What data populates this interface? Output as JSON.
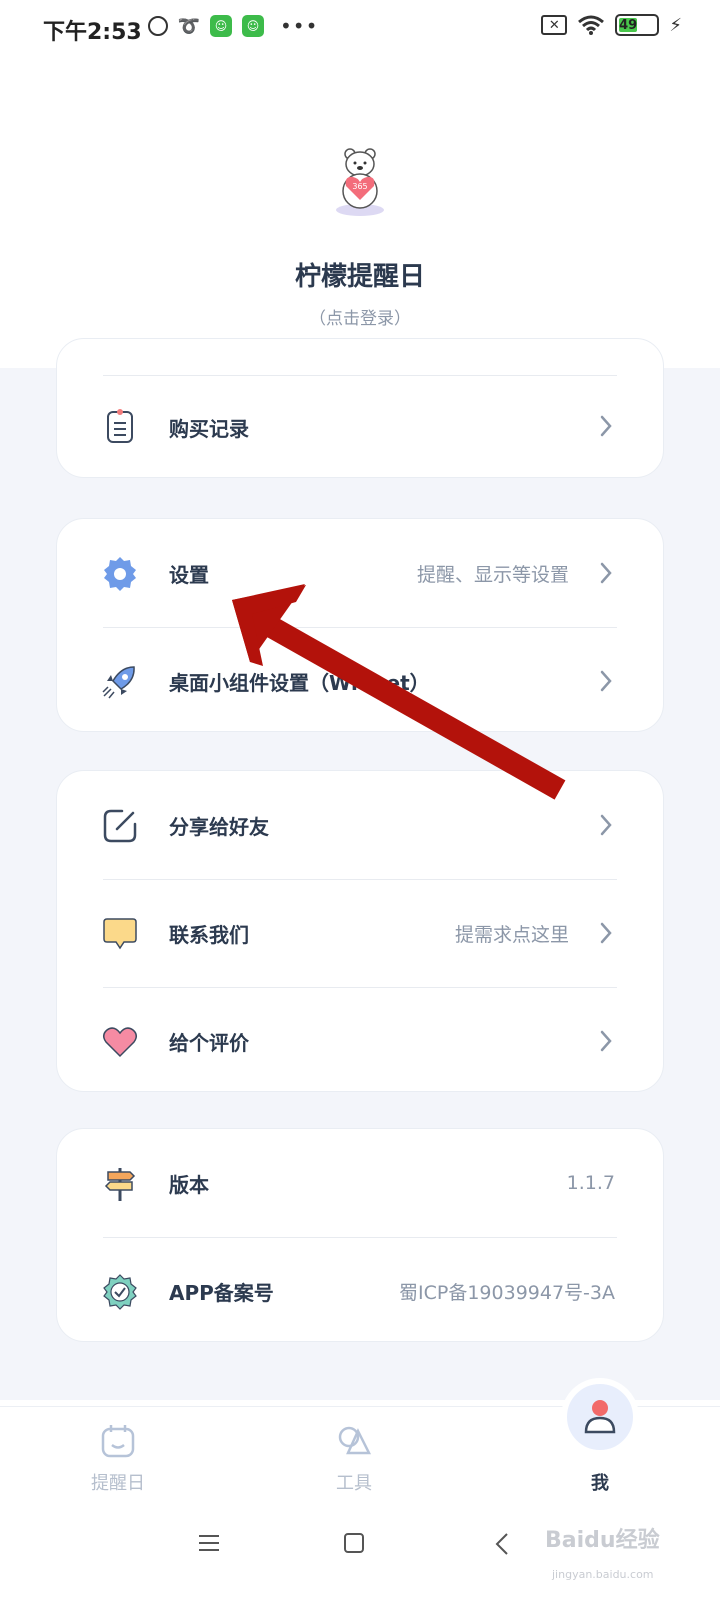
{
  "status_bar": {
    "time": "下午2:53",
    "battery": "49"
  },
  "profile": {
    "app_name": "柠檬提醒日",
    "login_hint": "（点击登录）"
  },
  "cards": [
    {
      "rows": [
        {
          "icon": "clipboard-icon",
          "label": "购买记录",
          "value": ""
        }
      ]
    },
    {
      "rows": [
        {
          "icon": "gear-icon",
          "label": "设置",
          "value": "提醒、显示等设置"
        },
        {
          "icon": "rocket-icon",
          "label": "桌面小组件设置（Widget）",
          "value": ""
        }
      ]
    },
    {
      "rows": [
        {
          "icon": "share-icon",
          "label": "分享给好友",
          "value": ""
        },
        {
          "icon": "message-icon",
          "label": "联系我们",
          "value": "提需求点这里"
        },
        {
          "icon": "heart-icon",
          "label": "给个评价",
          "value": ""
        }
      ]
    },
    {
      "rows": [
        {
          "icon": "signpost-icon",
          "label": "版本",
          "value": "1.1.7"
        },
        {
          "icon": "verified-badge-icon",
          "label": "APP备案号",
          "value": "蜀ICP备19039947号-3A"
        }
      ]
    }
  ],
  "bottom_nav": [
    {
      "icon": "calendar-icon",
      "label": "提醒日",
      "active": false
    },
    {
      "icon": "tools-icon",
      "label": "工具",
      "active": false
    },
    {
      "icon": "user-icon",
      "label": "我",
      "active": true
    }
  ],
  "watermark": {
    "main": "Baidu经验",
    "sub": "jingyan.baidu.com"
  },
  "colors": {
    "accent": "#4a6cf7",
    "arrow": "#b3120b",
    "background": "#f3f5fa",
    "icon_blue": "#6f9be8"
  }
}
